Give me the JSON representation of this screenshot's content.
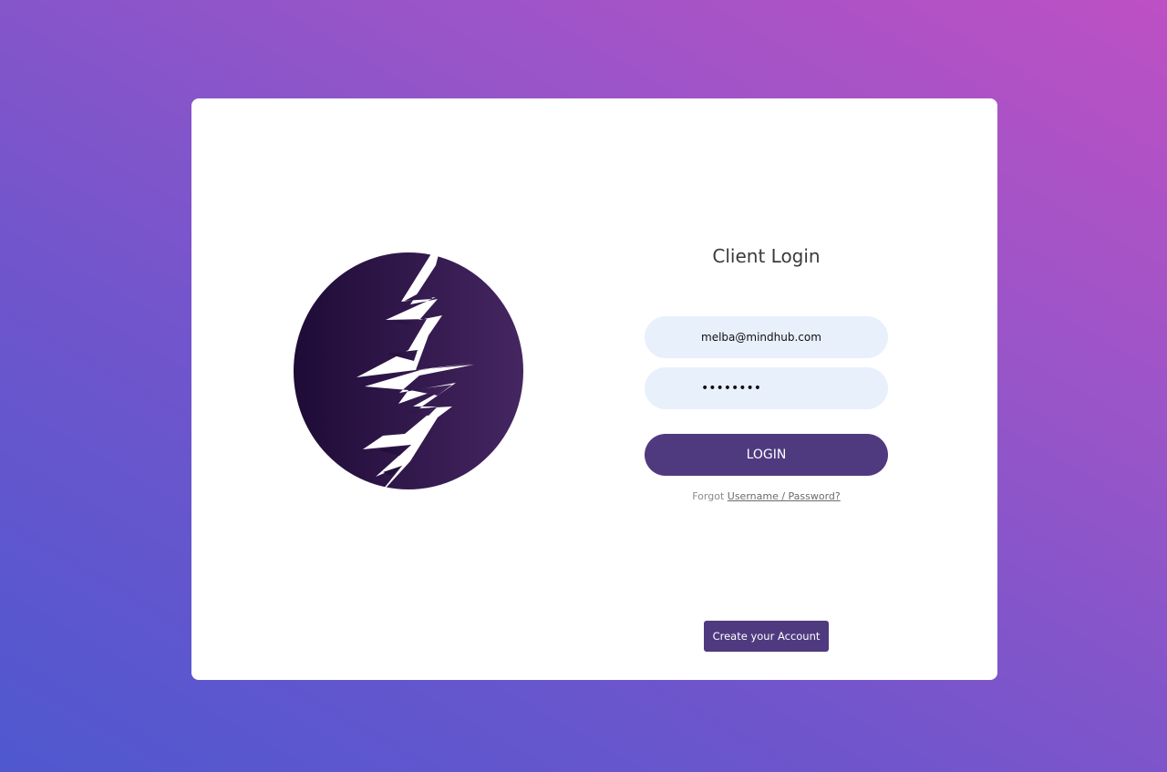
{
  "login_form": {
    "title": "Client Login",
    "email_value": "melba@mindhub.com",
    "password_value": "••••••••",
    "login_label": "LOGIN",
    "forgot_prefix": "Forgot",
    "forgot_link": "Username / Password?",
    "create_account_label": "Create your Account"
  },
  "colors": {
    "accent": "#4f3a80",
    "input_bg": "#e8f0fc",
    "logo_dark": "#1e0b36",
    "logo_light": "#452661"
  }
}
